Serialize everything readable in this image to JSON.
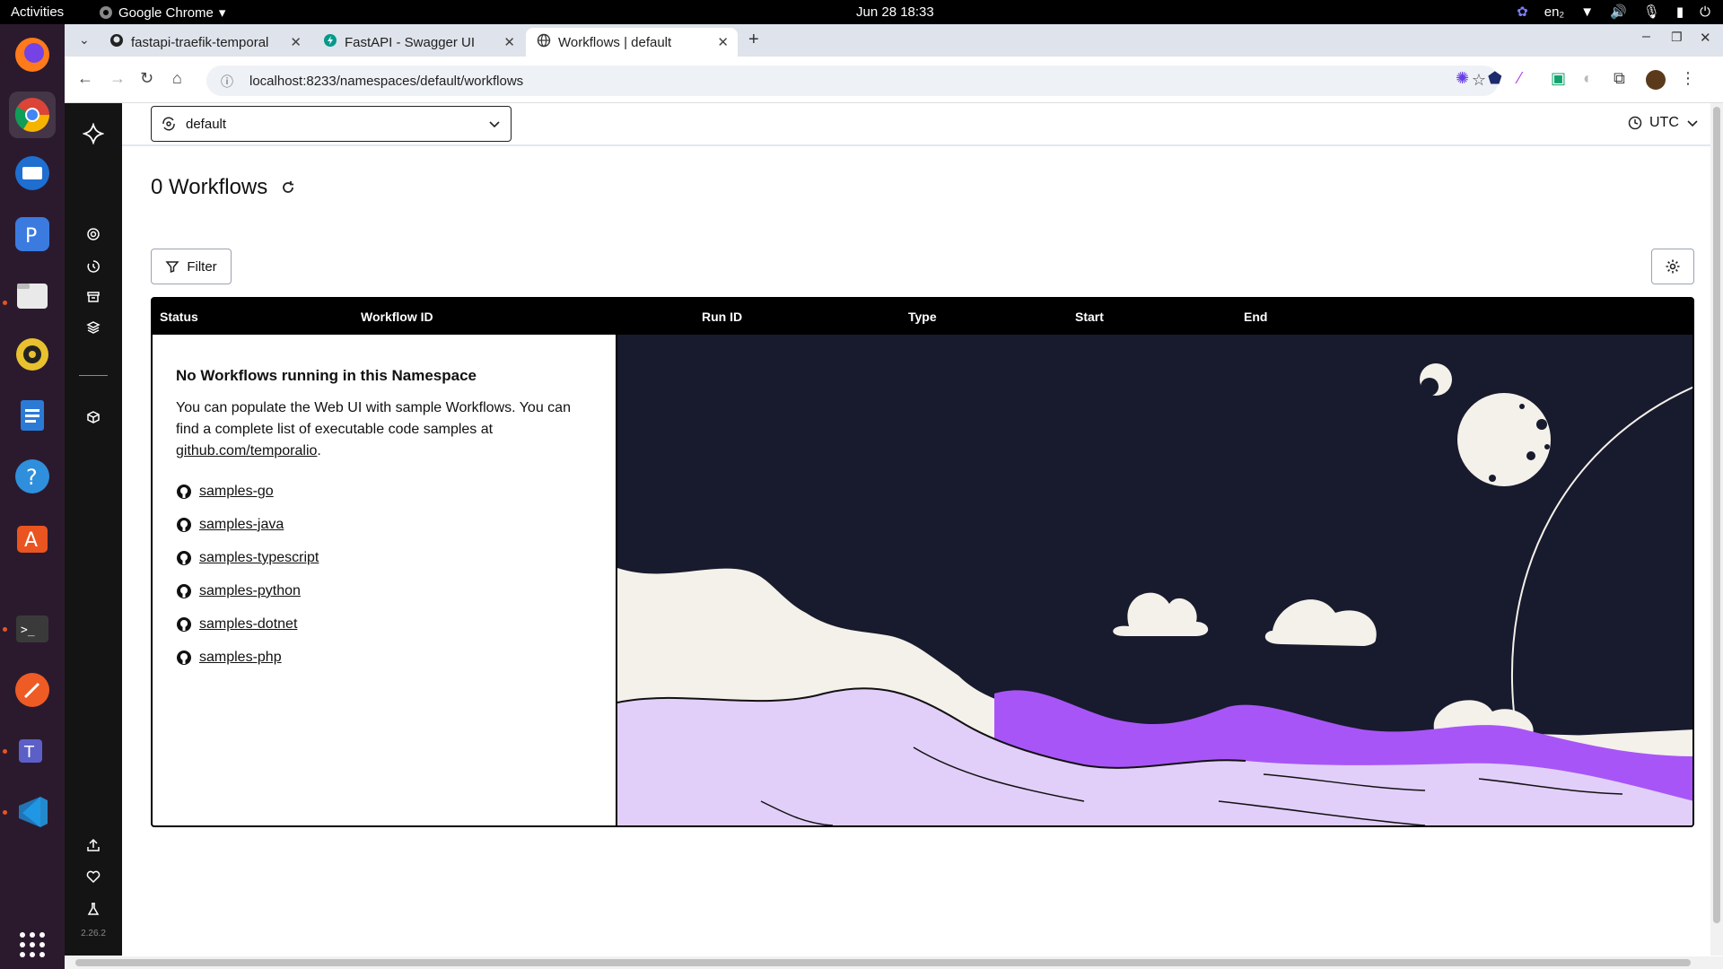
{
  "system": {
    "activities": "Activities",
    "app_name": "Google Chrome",
    "clock": "Jun 28  18:33",
    "lang": "en₂"
  },
  "browser": {
    "tabs": [
      {
        "label": "fastapi-traefik-temporal",
        "icon": "github-icon"
      },
      {
        "label": "FastAPI - Swagger UI",
        "icon": "fastapi-icon"
      },
      {
        "label": "Workflows | default",
        "icon": "globe-icon",
        "active": true
      }
    ],
    "url": "localhost:8233/namespaces/default/workflows"
  },
  "app": {
    "namespace": "default",
    "timezone": "UTC",
    "title": "0 Workflows",
    "filter_label": "Filter",
    "version": "2.26.2",
    "columns": [
      "Status",
      "Workflow ID",
      "Run ID",
      "Type",
      "Start",
      "End"
    ],
    "empty": {
      "heading": "No Workflows running in this Namespace",
      "text": "You can populate the Web UI with sample Workflows. You can find a complete list of executable code samples at",
      "link": "github.com/temporalio",
      "period": "."
    },
    "samples": [
      "samples-go",
      "samples-java",
      "samples-typescript",
      "samples-python",
      "samples-dotnet",
      "samples-php"
    ]
  },
  "colors": {
    "sidebar": "#141414",
    "night_sky": "#181a2e",
    "lavender": "#e1cffa",
    "purple": "#a855f7",
    "dock": "#2b1a2e"
  }
}
